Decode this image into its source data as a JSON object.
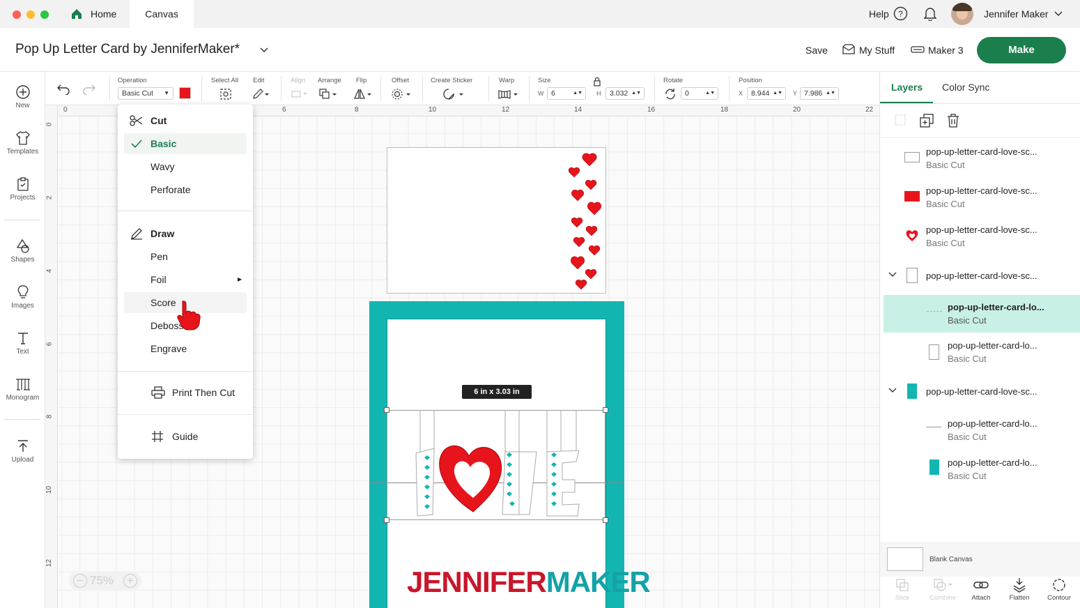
{
  "tabs": {
    "home": "Home",
    "canvas": "Canvas"
  },
  "topbar": {
    "help": "Help",
    "user_name": "Jennifer Maker"
  },
  "header": {
    "title": "Pop Up Letter Card by JenniferMaker*",
    "save": "Save",
    "my_stuff": "My Stuff",
    "machine": "Maker 3",
    "make": "Make"
  },
  "sidebar": {
    "items": [
      "New",
      "Templates",
      "Projects",
      "Shapes",
      "Images",
      "Text",
      "Monogram",
      "Upload"
    ]
  },
  "toolbar": {
    "operation_label": "Operation",
    "operation_value": "Basic Cut",
    "select_all": "Select All",
    "edit": "Edit",
    "align": "Align",
    "arrange": "Arrange",
    "flip": "Flip",
    "offset": "Offset",
    "create_sticker": "Create Sticker",
    "warp": "Warp",
    "size": "Size",
    "w_label": "W",
    "w_value": "6",
    "h_label": "H",
    "h_value": "3.032",
    "rotate": "Rotate",
    "rotate_value": "0",
    "position": "Position",
    "x_label": "X",
    "x_value": "8.944",
    "y_label": "Y",
    "y_value": "7.986",
    "operation_color": "#e8141c"
  },
  "ruler": {
    "top": [
      "0",
      "6",
      "8",
      "10",
      "12",
      "14",
      "16",
      "18",
      "20",
      "22"
    ],
    "left": [
      "0",
      "2",
      "4",
      "6",
      "8",
      "10",
      "12"
    ]
  },
  "menu": {
    "cut_head": "Cut",
    "cut_items": [
      "Basic",
      "Wavy",
      "Perforate"
    ],
    "draw_head": "Draw",
    "draw_items": [
      "Pen",
      "Foil",
      "Score",
      "Deboss",
      "Engrave"
    ],
    "print_then_cut": "Print Then Cut",
    "guide": "Guide",
    "selected": "Basic"
  },
  "canvas": {
    "size_badge": "6 in x 3.03 in",
    "zoom": "75%",
    "watermark_a": "JENNIFER",
    "watermark_b": "MAKER"
  },
  "panel": {
    "tabs": [
      "Layers",
      "Color Sync"
    ],
    "layers": [
      {
        "name": "pop-up-letter-card-love-sc...",
        "sub": "Basic Cut"
      },
      {
        "name": "pop-up-letter-card-love-sc...",
        "sub": "Basic Cut"
      },
      {
        "name": "pop-up-letter-card-love-sc...",
        "sub": "Basic Cut"
      },
      {
        "name": "pop-up-letter-card-love-sc...",
        "sub": ""
      },
      {
        "name": "pop-up-letter-card-lo...",
        "sub": "Basic Cut"
      },
      {
        "name": "pop-up-letter-card-lo...",
        "sub": "Basic Cut"
      },
      {
        "name": "pop-up-letter-card-love-sc...",
        "sub": ""
      },
      {
        "name": "pop-up-letter-card-lo...",
        "sub": "Basic Cut"
      },
      {
        "name": "pop-up-letter-card-lo...",
        "sub": "Basic Cut"
      }
    ],
    "blank_canvas": "Blank Canvas",
    "bottom": [
      "Slice",
      "Combine",
      "Attach",
      "Flatten",
      "Contour"
    ]
  },
  "colors": {
    "brand_green": "#1a7e4d",
    "teal": "#13b5b1",
    "red": "#e8141c"
  }
}
